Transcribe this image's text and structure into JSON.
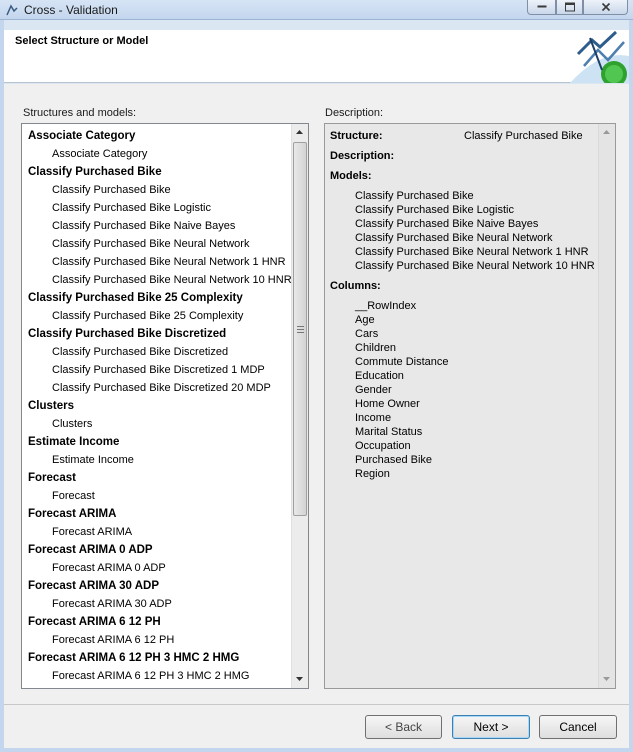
{
  "window": {
    "title": "Cross - Validation"
  },
  "header": {
    "title": "Select Structure or Model"
  },
  "structures_panel": {
    "label": "Structures and models:",
    "groups": [
      {
        "name": "Associate Category",
        "models": [
          "Associate Category"
        ]
      },
      {
        "name": "Classify Purchased Bike",
        "models": [
          "Classify Purchased Bike",
          "Classify Purchased Bike Logistic",
          "Classify Purchased Bike Naive Bayes",
          "Classify Purchased Bike Neural Network",
          "Classify Purchased Bike Neural Network 1 HNR",
          "Classify Purchased Bike Neural Network 10 HNR"
        ]
      },
      {
        "name": "Classify Purchased Bike 25 Complexity",
        "models": [
          "Classify Purchased Bike 25 Complexity"
        ]
      },
      {
        "name": "Classify Purchased Bike Discretized",
        "models": [
          "Classify Purchased Bike Discretized",
          "Classify Purchased Bike Discretized 1 MDP",
          "Classify Purchased Bike Discretized 20 MDP"
        ]
      },
      {
        "name": "Clusters",
        "models": [
          "Clusters"
        ]
      },
      {
        "name": "Estimate Income",
        "models": [
          "Estimate Income"
        ]
      },
      {
        "name": "Forecast",
        "models": [
          "Forecast"
        ]
      },
      {
        "name": "Forecast ARIMA",
        "models": [
          "Forecast ARIMA"
        ]
      },
      {
        "name": "Forecast ARIMA 0 ADP",
        "models": [
          "Forecast ARIMA 0 ADP"
        ]
      },
      {
        "name": "Forecast ARIMA 30 ADP",
        "models": [
          "Forecast ARIMA 30 ADP"
        ]
      },
      {
        "name": "Forecast ARIMA 6 12 PH",
        "models": [
          "Forecast ARIMA 6 12 PH"
        ]
      },
      {
        "name": "Forecast ARIMA 6 12 PH 3 HMC 2 HMG",
        "models": [
          "Forecast ARIMA 6 12 PH 3 HMC 2 HMG"
        ]
      }
    ]
  },
  "description_panel": {
    "label": "Description:",
    "structure_label": "Structure:",
    "structure_value": "Classify Purchased Bike",
    "description_label": "Description:",
    "models_label": "Models:",
    "models": [
      "Classify Purchased Bike",
      "Classify Purchased Bike Logistic",
      "Classify Purchased Bike Naive Bayes",
      "Classify Purchased Bike Neural Network",
      "Classify Purchased Bike Neural Network 1 HNR",
      "Classify Purchased Bike Neural Network 10 HNR"
    ],
    "columns_label": "Columns:",
    "columns": [
      "__RowIndex",
      "Age",
      "Cars",
      "Children",
      "Commute Distance",
      "Education",
      "Gender",
      "Home Owner",
      "Income",
      "Marital Status",
      "Occupation",
      "Purchased Bike",
      "Region"
    ]
  },
  "footer": {
    "back_label": "< Back",
    "next_label": "Next >",
    "cancel_label": "Cancel"
  }
}
